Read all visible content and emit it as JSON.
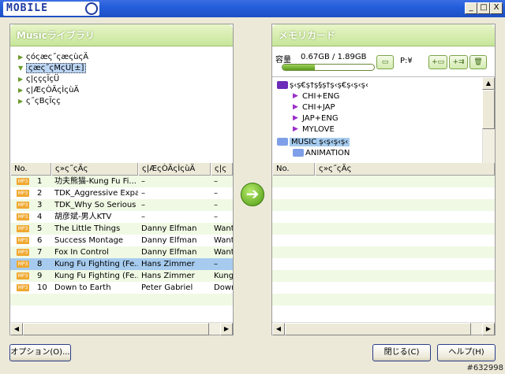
{
  "window": {
    "logo_text": "MOBILE",
    "minimize": "_",
    "maximize": "□",
    "close": "X"
  },
  "left_panel": {
    "title": "Musicライブラリ",
    "tree": [
      {
        "label": "ςόςæς˝ςæςùςÄ",
        "expanded": false
      },
      {
        "label": "ςæς˝ςMςU[±]",
        "expanded": true,
        "selected": true
      },
      {
        "label": "ς|ςçςÏçÜ",
        "expanded": false
      },
      {
        "label": "ς|ÆςÒÄςÌςùÄ",
        "expanded": false
      },
      {
        "label": "ς˝ςBςÏςç",
        "expanded": false
      }
    ],
    "columns": [
      "No.",
      "ς»ς˝ςÄς",
      "ς|ÆςÒÄςÌςùÄ",
      "ς|ς"
    ],
    "rows": [
      {
        "no": "1",
        "title": "功夫熊猫-Kung Fu Fi...",
        "artist": "–",
        "album": "–"
      },
      {
        "no": "2",
        "title": "TDK_Aggressive Expa...",
        "artist": "–",
        "album": "–"
      },
      {
        "no": "3",
        "title": "TDK_Why So Serious",
        "artist": "–",
        "album": "–"
      },
      {
        "no": "4",
        "title": "胡彦斌-男人KTV",
        "artist": "–",
        "album": "–"
      },
      {
        "no": "5",
        "title": "The Little Things",
        "artist": "Danny Elfman",
        "album": "Want"
      },
      {
        "no": "6",
        "title": "Success Montage",
        "artist": "Danny Elfman",
        "album": "Want"
      },
      {
        "no": "7",
        "title": "Fox In Control",
        "artist": "Danny Elfman",
        "album": "Want"
      },
      {
        "no": "8",
        "title": "Kung Fu Fighting (Fe...",
        "artist": "Hans Zimmer",
        "album": "–",
        "selected": true
      },
      {
        "no": "9",
        "title": "Kung Fu Fighting (Fe...",
        "artist": "Hans Zimmer",
        "album": "Kung"
      },
      {
        "no": "10",
        "title": "Down to Earth",
        "artist": "Peter Gabriel",
        "album": "Down"
      }
    ],
    "file_badge": "MP3"
  },
  "right_panel": {
    "title": "メモリカード",
    "capacity_label": "容量",
    "capacity_value": "0.67GB / 1.89GB",
    "capacity_fraction": 0.354,
    "drive_label": "P:¥",
    "tree": [
      {
        "label": "ș‹ș€ș†ș§ș†ș‹ș€ș‹ș‹ș‹",
        "indent": 0,
        "icon": "folder-purple"
      },
      {
        "label": "CHI+ENG",
        "indent": 1,
        "icon": "playlist"
      },
      {
        "label": "CHI+JAP",
        "indent": 1,
        "icon": "playlist"
      },
      {
        "label": "JAP+ENG",
        "indent": 1,
        "icon": "playlist"
      },
      {
        "label": "MYLOVE",
        "indent": 1,
        "icon": "playlist"
      },
      {
        "label": "MUSIC ș‹ș‹ș‹ș‹",
        "indent": 0,
        "icon": "folder",
        "selected": true
      },
      {
        "label": "ANIMATION",
        "indent": 1,
        "icon": "folder"
      }
    ],
    "columns": [
      "No.",
      "ς»ς˝ςÄς"
    ]
  },
  "buttons": {
    "options": "オプション(O)...",
    "close": "閉じる(C)",
    "help": "ヘルプ(H)"
  },
  "watermark": "#632998"
}
